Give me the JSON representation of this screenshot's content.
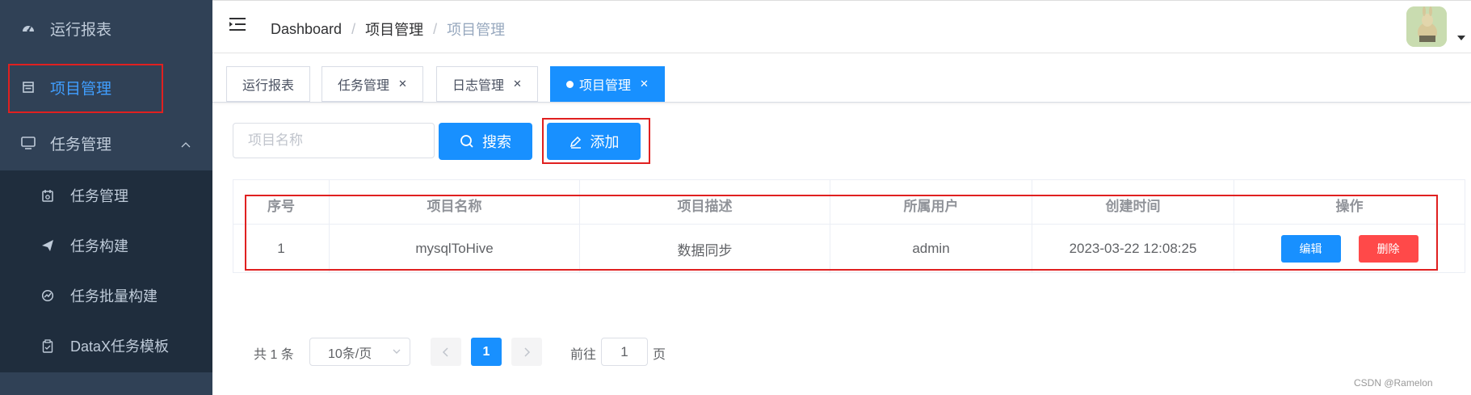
{
  "sidebar": {
    "items": [
      {
        "label": "运行报表",
        "icon": "dashboard-icon"
      },
      {
        "label": "项目管理",
        "icon": "table-icon",
        "active": true
      },
      {
        "label": "任务管理",
        "icon": "monitor-icon",
        "expanded": true
      }
    ],
    "sub_items": [
      {
        "label": "任务管理",
        "icon": "calendar-icon"
      },
      {
        "label": "任务构建",
        "icon": "paper-plane-icon"
      },
      {
        "label": "任务批量构建",
        "icon": "chart-icon"
      },
      {
        "label": "DataX任务模板",
        "icon": "clipboard-icon"
      }
    ]
  },
  "header": {
    "breadcrumb": [
      "Dashboard",
      "项目管理",
      "项目管理"
    ]
  },
  "tags": [
    {
      "label": "运行报表",
      "closable": false
    },
    {
      "label": "任务管理",
      "closable": true
    },
    {
      "label": "日志管理",
      "closable": true
    },
    {
      "label": "项目管理",
      "closable": true,
      "active": true
    }
  ],
  "search": {
    "placeholder": "项目名称",
    "value": "",
    "search_label": "搜索",
    "add_label": "添加"
  },
  "table": {
    "columns": [
      "序号",
      "项目名称",
      "项目描述",
      "所属用户",
      "创建时间",
      "操作"
    ],
    "rows": [
      {
        "index": "1",
        "name": "mysqlToHive",
        "description": "数据同步",
        "user": "admin",
        "created": "2023-03-22 12:08:25"
      }
    ],
    "edit_label": "编辑",
    "delete_label": "删除"
  },
  "pagination": {
    "total_text": "共 1 条",
    "page_size": "10条/页",
    "current_page": "1",
    "goto_label": "前往",
    "goto_value": "1",
    "page_unit": "页"
  },
  "watermark": "CSDN @Ramelon",
  "colors": {
    "sidebar_bg": "#304156",
    "submenu_bg": "#1f2d3d",
    "primary": "#1890ff",
    "danger": "#ff4949",
    "highlight_border": "#e02020"
  }
}
